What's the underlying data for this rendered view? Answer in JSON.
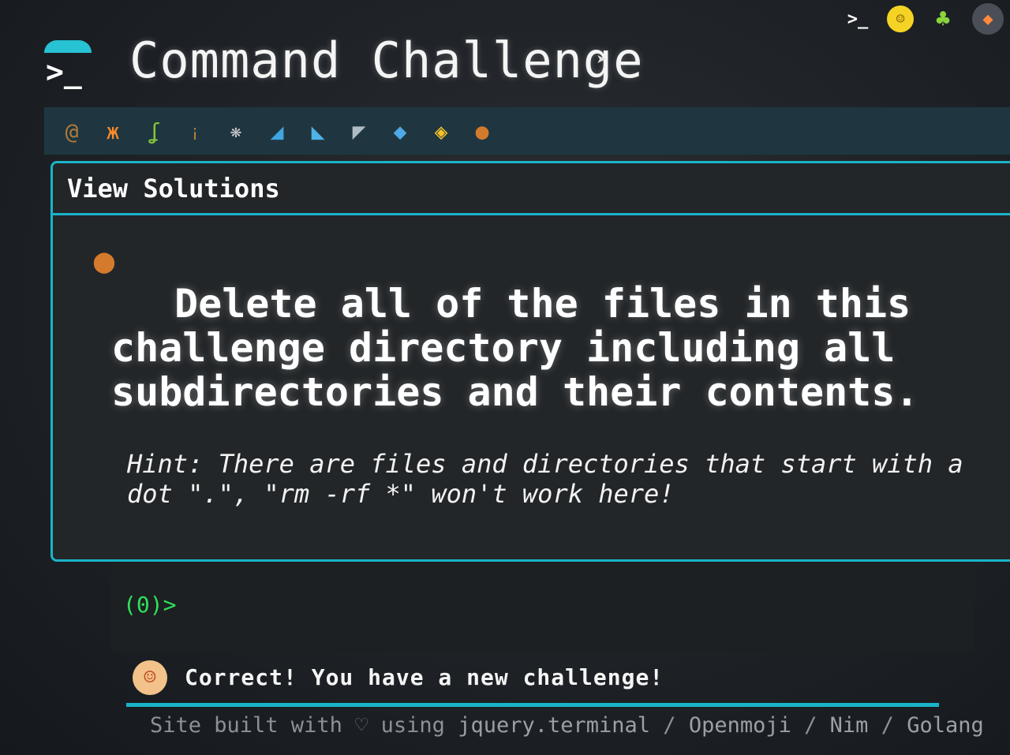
{
  "app": {
    "title": "Command Challenge",
    "logo_glyph": ">_"
  },
  "top_icons": [
    {
      "name": "terminal-icon",
      "glyph": ">_"
    },
    {
      "name": "shushing-face-icon",
      "glyph": "☺"
    },
    {
      "name": "tree-icon",
      "glyph": "♣"
    },
    {
      "name": "fox-icon",
      "glyph": "◆"
    }
  ],
  "levels": [
    {
      "name": "snail-icon",
      "glyph": "@"
    },
    {
      "name": "butterfly-icon",
      "glyph": "ж"
    },
    {
      "name": "worm-icon",
      "glyph": "ʆ"
    },
    {
      "name": "ant-icon",
      "glyph": "¡"
    },
    {
      "name": "spider-web-icon",
      "glyph": "❋"
    },
    {
      "name": "whale-icon",
      "glyph": "◢"
    },
    {
      "name": "dolphin-icon",
      "glyph": "◣"
    },
    {
      "name": "shark-icon",
      "glyph": "◤"
    },
    {
      "name": "fish-icon",
      "glyph": "◆"
    },
    {
      "name": "tropical-fish-icon",
      "glyph": "◈"
    },
    {
      "name": "blowfish-icon",
      "glyph": "●"
    }
  ],
  "panel": {
    "title": "View Solutions",
    "close_glyph": "×",
    "challenge_icon_glyph": "●",
    "challenge": "Delete all of the files in this challenge directory including all subdirectories and their contents.",
    "hint": "Hint: There are files and directories that start with a dot \".\", \"rm -rf *\" won't work here!"
  },
  "terminal": {
    "prompt": "(0)>"
  },
  "status": {
    "avatar_glyph": "☺",
    "message": "Correct! You have a new challenge!"
  },
  "footer": {
    "prefix": "Site built with",
    "heart": "♡",
    "middle": "using",
    "links": [
      "jquery.terminal",
      "Openmoji",
      "Nim",
      "Golang"
    ],
    "separator": " / "
  }
}
